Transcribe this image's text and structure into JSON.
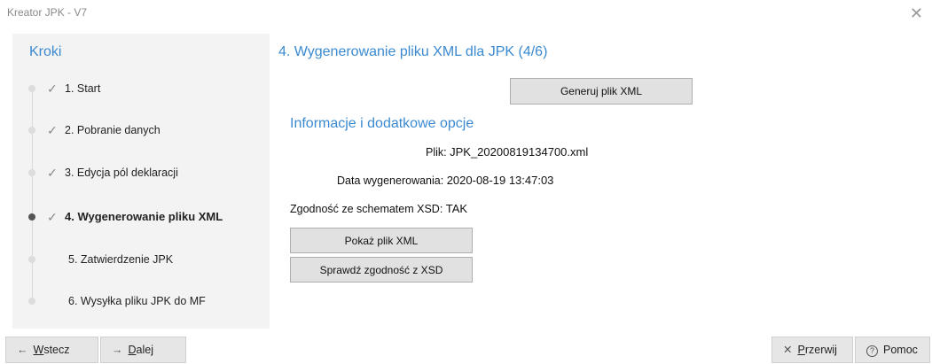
{
  "window": {
    "title": "Kreator JPK - V7",
    "close_glyph": "✕"
  },
  "sidebar": {
    "heading": "Kroki",
    "check_glyph": "✓",
    "steps": [
      {
        "label": "1. Start",
        "done": true
      },
      {
        "label": "2. Pobranie danych",
        "done": true
      },
      {
        "label": "3. Edycja pól deklaracji",
        "done": true
      },
      {
        "label": "4. Wygenerowanie pliku XML",
        "done": true,
        "current": true
      },
      {
        "label": "5. Zatwierdzenie JPK",
        "done": false
      },
      {
        "label": "6. Wysyłka pliku JPK do MF",
        "done": false
      }
    ]
  },
  "main": {
    "title": "4. Wygenerowanie pliku XML dla JPK (4/6)",
    "generate_button": "Generuj plik XML",
    "section_title": "Informacje i dodatkowe opcje",
    "file_label": "Plik:",
    "file_value": "JPK_20200819134700.xml",
    "date_label": "Data wygenerowania:",
    "date_value": "2020-08-19 13:47:03",
    "xsd_label": "Zgodność ze schematem XSD:",
    "xsd_value": "TAK",
    "show_xml_button": "Pokaż plik XML",
    "check_xsd_button": "Sprawdź zgodność z XSD"
  },
  "footer": {
    "back_icon": "←",
    "back_key": "W",
    "back_rest": "stecz",
    "next_icon": "→",
    "next_key": "D",
    "next_rest": "alej",
    "cancel_icon": "✕",
    "cancel_key": "P",
    "cancel_rest": "rzerwij",
    "help_icon": "?",
    "help_label": "Pomoc"
  }
}
